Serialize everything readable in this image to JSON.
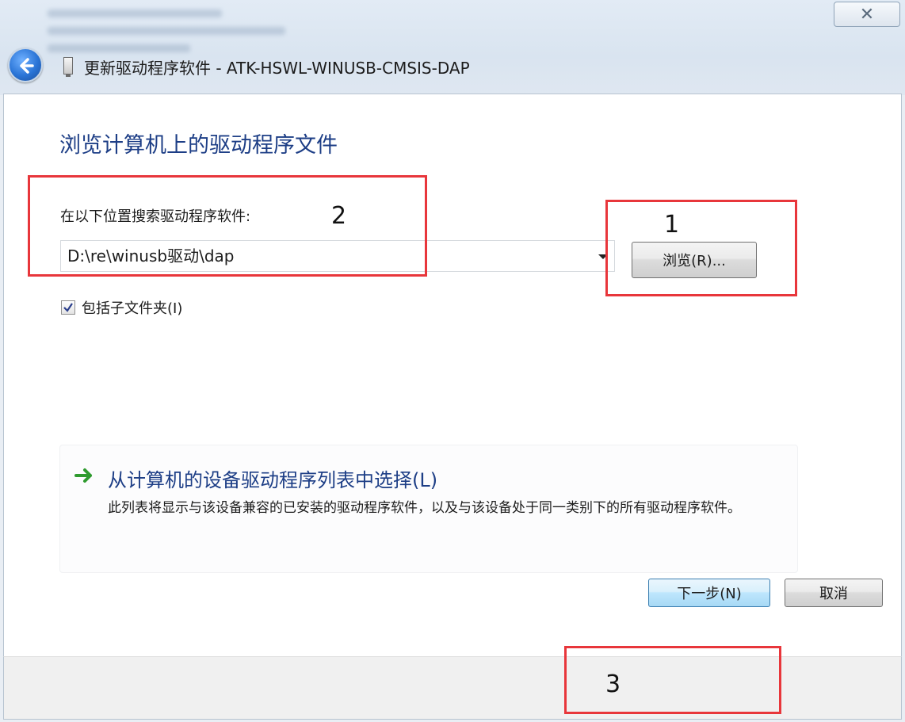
{
  "window": {
    "title": "更新驱动程序软件 - ATK-HSWL-WINUSB-CMSIS-DAP",
    "close_glyph": "✕"
  },
  "main": {
    "heading": "浏览计算机上的驱动程序文件",
    "search_label": "在以下位置搜索驱动程序软件:",
    "path_value": "D:\\re\\winusb驱动\\dap",
    "browse_label": "浏览(R)...",
    "include_subfolders_label": "包括子文件夹(I)",
    "include_subfolders_checked": true
  },
  "pick_link": {
    "title": "从计算机的设备驱动程序列表中选择(L)",
    "description": "此列表将显示与该设备兼容的已安装的驱动程序软件，以及与该设备处于同一类别下的所有驱动程序软件。"
  },
  "footer": {
    "next_label": "下一步(N)",
    "cancel_label": "取消"
  },
  "annotations": {
    "one": "1",
    "two": "2",
    "three": "3"
  },
  "colors": {
    "heading": "#1d3e86",
    "annotation_box": "#e8363b",
    "link_arrow": "#2f9b2f"
  },
  "icons": {
    "back": "back-arrow-icon",
    "device": "usb-device-icon",
    "link": "green-arrow-icon"
  }
}
